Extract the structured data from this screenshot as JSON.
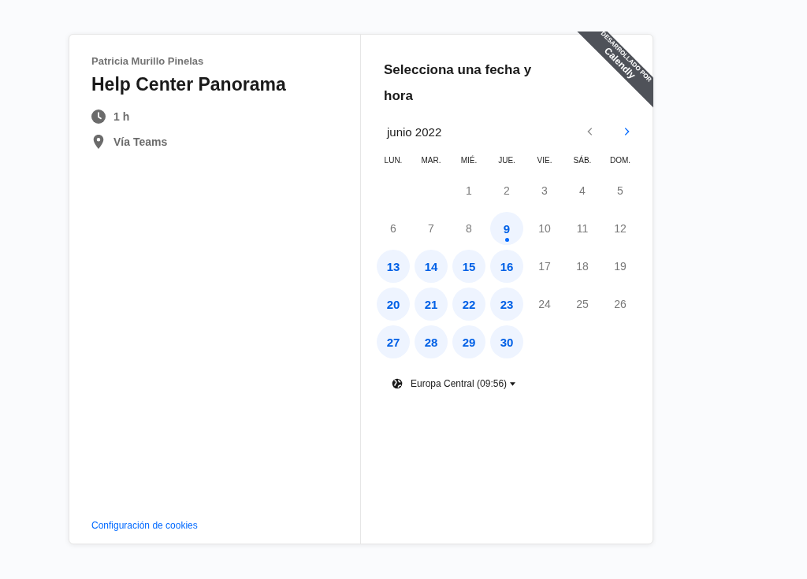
{
  "host": "Patricia Murillo Pinelas",
  "event_title": "Help Center Panorama",
  "details": [
    {
      "kind": "duration",
      "text": "1 h"
    },
    {
      "kind": "location",
      "text": "Vía Teams"
    }
  ],
  "cookie_link": "Configuración de cookies",
  "ribbon": {
    "top": "DESARROLLADO POR",
    "brand": "Calendly"
  },
  "heading": "Selecciona una fecha y hora",
  "calendar": {
    "month": "junio 2022",
    "prev_disabled": true,
    "next_disabled": false,
    "weekdays": [
      "LUN.",
      "MAR.",
      "MIÉ.",
      "JUE.",
      "VIE.",
      "SÁB.",
      "DOM."
    ],
    "weeks": [
      [
        {
          "day": "1",
          "available": false,
          "today": false
        },
        {
          "day": "2",
          "available": false,
          "today": false
        },
        {
          "day": "3",
          "available": false,
          "today": false
        },
        {
          "day": "4",
          "available": false,
          "today": false
        },
        {
          "day": "5",
          "available": false,
          "today": false
        }
      ],
      [
        {
          "day": "6",
          "available": false,
          "today": false
        },
        {
          "day": "7",
          "available": false,
          "today": false
        },
        {
          "day": "8",
          "available": false,
          "today": false
        },
        {
          "day": "9",
          "available": true,
          "today": true
        },
        {
          "day": "10",
          "available": false,
          "today": false
        },
        {
          "day": "11",
          "available": false,
          "today": false
        },
        {
          "day": "12",
          "available": false,
          "today": false
        }
      ],
      [
        {
          "day": "13",
          "available": true,
          "today": false
        },
        {
          "day": "14",
          "available": true,
          "today": false
        },
        {
          "day": "15",
          "available": true,
          "today": false
        },
        {
          "day": "16",
          "available": true,
          "today": false
        },
        {
          "day": "17",
          "available": false,
          "today": false
        },
        {
          "day": "18",
          "available": false,
          "today": false
        },
        {
          "day": "19",
          "available": false,
          "today": false
        }
      ],
      [
        {
          "day": "20",
          "available": true,
          "today": false
        },
        {
          "day": "21",
          "available": true,
          "today": false
        },
        {
          "day": "22",
          "available": true,
          "today": false
        },
        {
          "day": "23",
          "available": true,
          "today": false
        },
        {
          "day": "24",
          "available": false,
          "today": false
        },
        {
          "day": "25",
          "available": false,
          "today": false
        },
        {
          "day": "26",
          "available": false,
          "today": false
        }
      ],
      [
        {
          "day": "27",
          "available": true,
          "today": false
        },
        {
          "day": "28",
          "available": true,
          "today": false
        },
        {
          "day": "29",
          "available": true,
          "today": false
        },
        {
          "day": "30",
          "available": true,
          "today": false
        }
      ]
    ]
  },
  "timezone": "Europa Central (09:56)"
}
